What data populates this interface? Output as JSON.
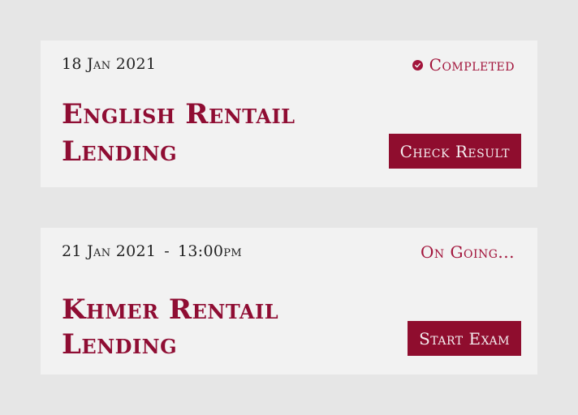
{
  "exams": [
    {
      "date": "18 Jan 2021",
      "time": "",
      "status": "Completed",
      "status_icon": "check-circle-icon",
      "title": "English Rentail Lending",
      "action_label": "Check Result"
    },
    {
      "date": "21 Jan 2021",
      "separator": "-",
      "time": "13:00pm",
      "status": "On Going...",
      "title": "Khmer Rentail Lending",
      "action_label": "Start Exam"
    }
  ],
  "colors": {
    "accent": "#8f0d2e",
    "status_text": "#a2143b",
    "card_bg": "#f2f2f2",
    "page_bg": "#e6e6e6"
  }
}
